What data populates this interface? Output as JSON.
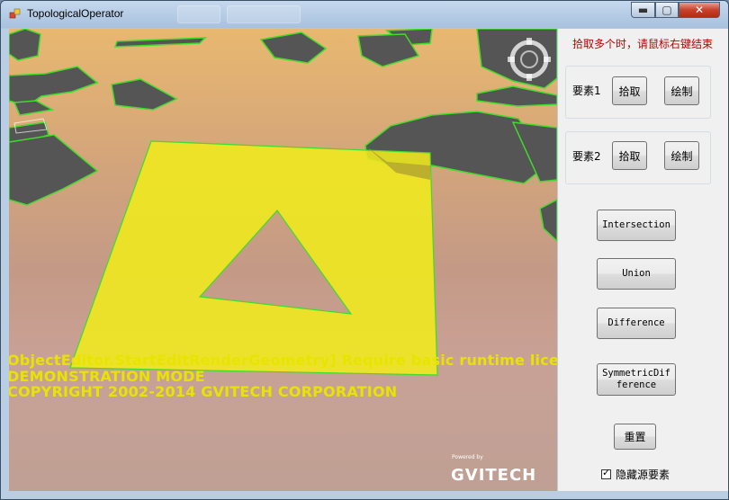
{
  "window": {
    "title": "TopologicalOperator",
    "controls": {
      "minimize": "▬",
      "maximize": "▢",
      "close": "✕"
    }
  },
  "viewport": {
    "overlay_lines": [
      "ObjectEditor.StartEditRenderGeometry] Require basic runtime licen",
      "DEMONSTRATION MODE",
      "COPYRIGHT 2002-2014 GVITECH CORPORATION"
    ],
    "powered_by": "Powered by",
    "brand": "GVITECH",
    "colors": {
      "polygon_fill": "#f0ea1c",
      "polygon_edge": "#3fdc2a",
      "buildings": "#555555"
    }
  },
  "panel": {
    "hint": "拾取多个时，请鼠标右键结束",
    "feature1": {
      "label": "要素1",
      "pick": "拾取",
      "draw": "绘制"
    },
    "feature2": {
      "label": "要素2",
      "pick": "拾取",
      "draw": "绘制"
    },
    "ops": {
      "intersection": "Intersection",
      "union": "Union",
      "difference": "Difference",
      "symmetric": "SymmetricDifference"
    },
    "reset": "重置",
    "hide_source": {
      "label": "隐藏源要素",
      "checked": true
    }
  }
}
